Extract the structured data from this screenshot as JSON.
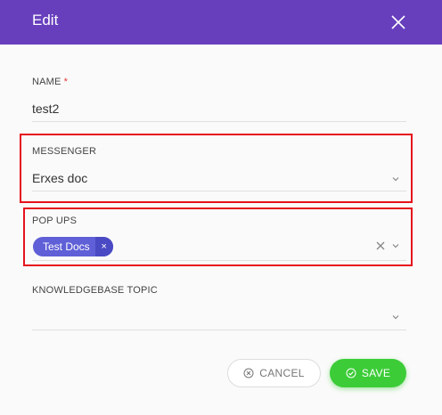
{
  "dialog": {
    "title": "Edit"
  },
  "form": {
    "name": {
      "label": "NAME",
      "required_mark": "*",
      "value": "test2"
    },
    "messenger": {
      "label": "MESSENGER",
      "value": "Erxes doc"
    },
    "popups": {
      "label": "POP UPS",
      "tags": [
        {
          "label": "Test Docs",
          "remove": "×"
        }
      ]
    },
    "knowledgebase": {
      "label": "KNOWLEDGEBASE TOPIC",
      "value": ""
    }
  },
  "actions": {
    "cancel_label": "CANCEL",
    "save_label": "SAVE"
  },
  "colors": {
    "header": "#673fbd",
    "highlight": "#e5131d",
    "tag": "#5f5fd7",
    "save": "#3ccc38"
  },
  "icons": {
    "close": "close-icon",
    "chevron": "chevron-down-icon",
    "cancel": "cancel-circle-icon",
    "save": "check-circle-icon"
  }
}
